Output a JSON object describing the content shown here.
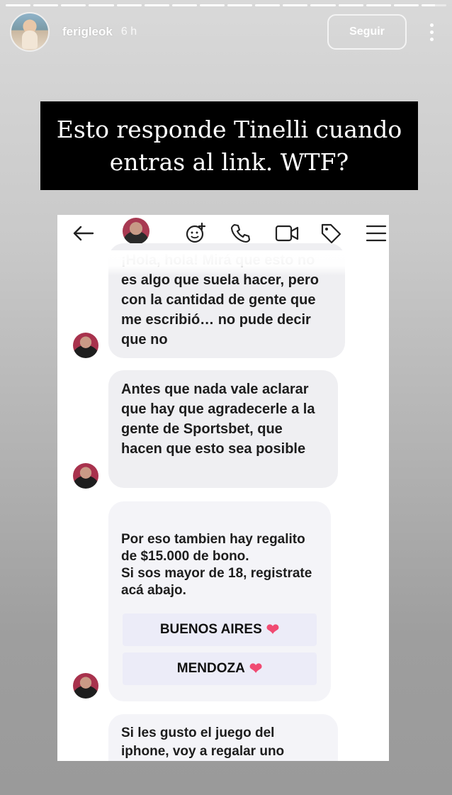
{
  "story": {
    "username": "ferigleok",
    "time": "6 h",
    "follow_label": "Seguir",
    "progress": [
      1,
      1,
      1,
      1,
      1,
      1,
      1,
      1,
      1,
      1,
      1,
      1,
      1,
      1,
      1,
      0.55
    ],
    "caption": "Esto responde Tinelli cuando entras al link. WTF?"
  },
  "chat": {
    "icons": [
      "back-arrow-icon",
      "contact-avatar",
      "add-friend-icon",
      "phone-icon",
      "video-icon",
      "tag-icon",
      "menu-icon"
    ],
    "messages": [
      {
        "text": "¡Hola, hola! Mirá que esto no es algo que suela hacer, pero con la cantidad de gente que me escribió… no pude decir que no"
      },
      {
        "text": "Antes que nada vale aclarar que hay que agradecerle a la gente de Sportsbet, que hacen que esto sea posible"
      },
      {
        "text": "Por eso tambien hay regalito de $15.000 de bono.\nSi sos mayor de 18, registrate acá abajo."
      },
      {
        "text": "Si les gusto el juego del iphone, voy a regalar uno"
      }
    ],
    "choices": [
      {
        "label": "BUENOS AIRES",
        "emoji": "❤"
      },
      {
        "label": "MENDOZA",
        "emoji": "❤"
      }
    ]
  },
  "colors": {
    "heart": "#f04a72",
    "bubble": "#efeff2",
    "caption_bg": "#000000"
  }
}
